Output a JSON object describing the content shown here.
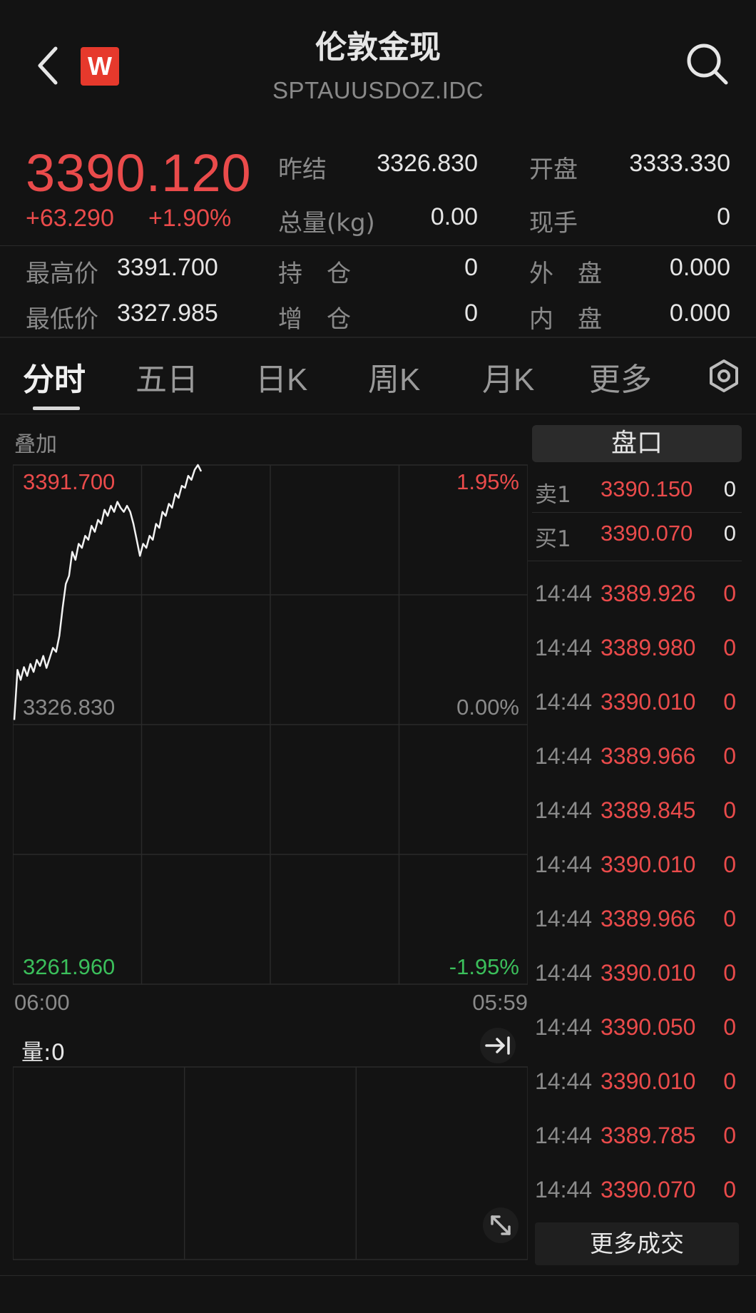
{
  "header": {
    "title": "伦敦金现",
    "subtitle": "SPTAUUSDOZ.IDC",
    "logo_letter": "W"
  },
  "quote": {
    "price": "3390.120",
    "change": "+63.290",
    "change_pct": "+1.90%",
    "prev_settle_label": "昨结",
    "prev_settle": "3326.830",
    "open_label": "开盘",
    "open": "3333.330",
    "volume_label": "总量(kg)",
    "volume": "0.00",
    "current_hand_label": "现手",
    "current_hand": "0",
    "high_label": "最高价",
    "high": "3391.700",
    "open_interest_label": "持　仓",
    "open_interest": "0",
    "outer_label": "外　盘",
    "outer": "0.000",
    "low_label": "最低价",
    "low": "3327.985",
    "oi_change_label": "增　仓",
    "oi_change": "0",
    "inner_label": "内　盘",
    "inner": "0.000"
  },
  "tabs": [
    {
      "label": "分时",
      "active": true
    },
    {
      "label": "五日"
    },
    {
      "label": "日K"
    },
    {
      "label": "周K"
    },
    {
      "label": "月K"
    },
    {
      "label": "更多"
    }
  ],
  "chart": {
    "overlay_label": "叠加",
    "y_top": "3391.700",
    "y_mid": "3326.830",
    "y_bottom": "3261.960",
    "pct_top": "1.95%",
    "pct_mid": "0.00%",
    "pct_bottom": "-1.95%",
    "x_start": "06:00",
    "x_end": "05:59",
    "volume_label": "量:0"
  },
  "chart_data": {
    "type": "line",
    "title": "",
    "xlabel": "",
    "ylabel": "",
    "ylim": [
      3261.96,
      3391.7
    ],
    "x_range": [
      "06:00",
      "05:59"
    ],
    "series": [
      {
        "values": [
          3328.0,
          3340.5,
          3338.0,
          3341.2,
          3339.0,
          3342.0,
          3340.0,
          3343.0,
          3341.5,
          3344.0,
          3341.0,
          3343.5,
          3346.0,
          3345.0,
          3349.0,
          3356.0,
          3362.0,
          3364.0,
          3370.0,
          3368.0,
          3372.0,
          3371.0,
          3374.0,
          3373.0,
          3376.5,
          3375.0,
          3378.0,
          3377.0,
          3380.5,
          3379.0,
          3381.5,
          3380.0,
          3382.5,
          3381.0,
          3380.0,
          3381.5,
          3380.0,
          3377.0,
          3373.0,
          3369.0,
          3372.0,
          3371.0,
          3374.0,
          3373.0,
          3377.0,
          3376.0,
          3380.0,
          3379.0,
          3382.0,
          3381.0,
          3384.5,
          3383.5,
          3386.5,
          3386.0,
          3389.0,
          3388.0,
          3390.5,
          3391.7,
          3390.12
        ]
      }
    ]
  },
  "orderbook": {
    "pankou_label": "盘口",
    "asks": [
      {
        "label": "卖1",
        "price": "3390.150",
        "qty": "0"
      }
    ],
    "bids": [
      {
        "label": "买1",
        "price": "3390.070",
        "qty": "0"
      }
    ]
  },
  "trades": [
    {
      "time": "14:44",
      "price": "3389.926",
      "qty": "0"
    },
    {
      "time": "14:44",
      "price": "3389.980",
      "qty": "0"
    },
    {
      "time": "14:44",
      "price": "3390.010",
      "qty": "0"
    },
    {
      "time": "14:44",
      "price": "3389.966",
      "qty": "0"
    },
    {
      "time": "14:44",
      "price": "3389.845",
      "qty": "0"
    },
    {
      "time": "14:44",
      "price": "3390.010",
      "qty": "0"
    },
    {
      "time": "14:44",
      "price": "3389.966",
      "qty": "0"
    },
    {
      "time": "14:44",
      "price": "3390.010",
      "qty": "0"
    },
    {
      "time": "14:44",
      "price": "3390.050",
      "qty": "0"
    },
    {
      "time": "14:44",
      "price": "3390.010",
      "qty": "0"
    },
    {
      "time": "14:44",
      "price": "3389.785",
      "qty": "0"
    },
    {
      "time": "14:44",
      "price": "3390.070",
      "qty": "0"
    }
  ],
  "more_trades_label": "更多成交",
  "colors": {
    "up": "#ea4b4b",
    "down": "#3bbf5b",
    "background": "#131313"
  },
  "icons": [
    "back-icon",
    "search-icon",
    "gear-icon",
    "jump-to-latest-icon",
    "expand-icon"
  ]
}
